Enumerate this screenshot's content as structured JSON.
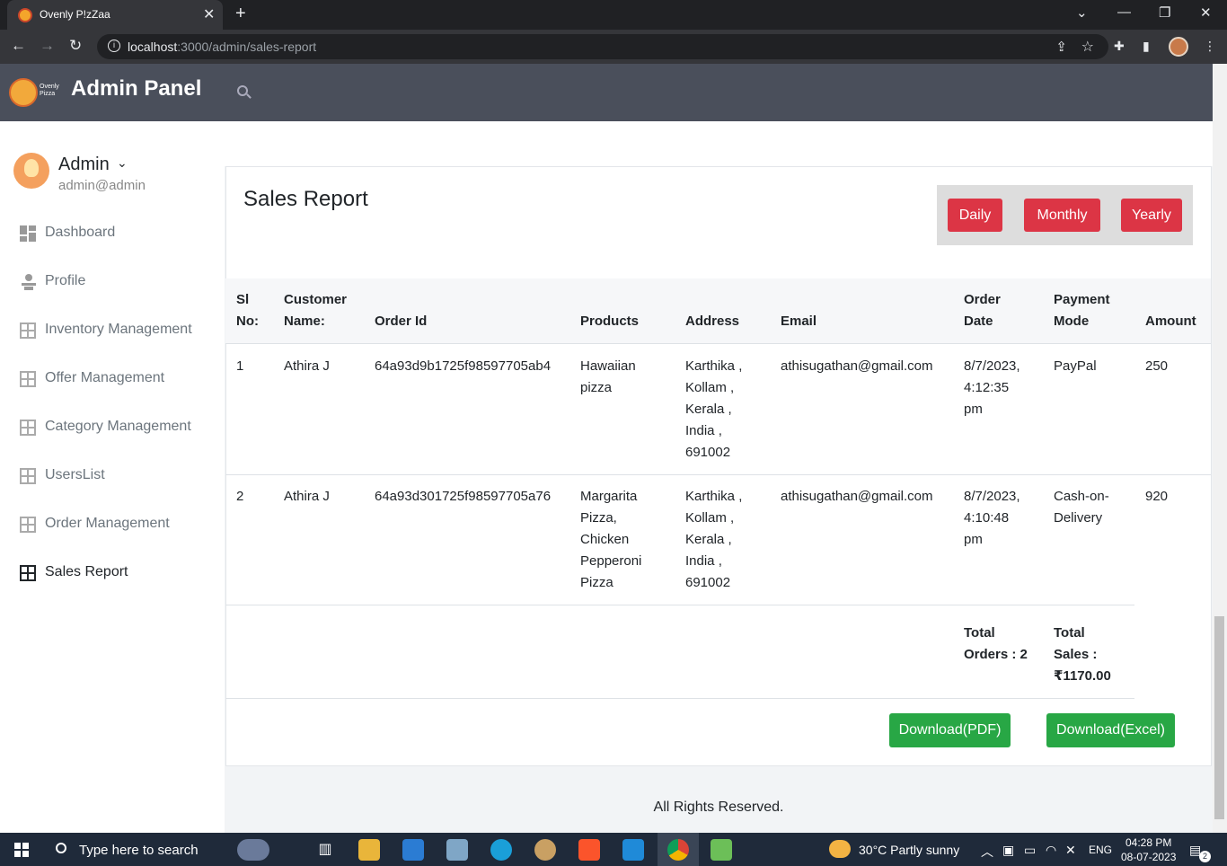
{
  "browser": {
    "tab_title": "Ovenly P!zZaa",
    "url_host": "localhost",
    "url_path": ":3000/admin/sales-report",
    "new_tab": "+",
    "tab_close": "✕"
  },
  "header": {
    "logo_text_line1": "Ovenly",
    "logo_text_line2": "Pizza",
    "title": "Admin Panel"
  },
  "sidebar": {
    "admin_name": "Admin",
    "admin_email": "admin@admin",
    "items": [
      {
        "label": "Dashboard"
      },
      {
        "label": "Profile"
      },
      {
        "label": "Inventory Management"
      },
      {
        "label": "Offer Management"
      },
      {
        "label": "Category Management"
      },
      {
        "label": "UsersList"
      },
      {
        "label": "Order Management"
      },
      {
        "label": "Sales Report"
      }
    ]
  },
  "report": {
    "title": "Sales Report",
    "filters": [
      "Daily",
      "Monthly",
      "Yearly"
    ],
    "columns": {
      "sl_1": "Sl",
      "sl_2": "No:",
      "customer_1": "Customer",
      "customer_2": "Name:",
      "order_id": "Order Id",
      "products": "Products",
      "address": "Address",
      "email": "Email",
      "order_date_1": "Order",
      "order_date_2": "Date",
      "payment_1": "Payment",
      "payment_2": "Mode",
      "amount": "Amount"
    },
    "rows": [
      {
        "sl": "1",
        "customer": "Athira J",
        "order_id": "64a93d9b1725f98597705ab4",
        "products": [
          "Hawaiian",
          "pizza"
        ],
        "address": [
          "Karthika ,",
          "Kollam ,",
          "Kerala ,",
          "India ,",
          "691002"
        ],
        "email": "athisugathan@gmail.com",
        "date": [
          "8/7/2023,",
          "4:12:35",
          "pm"
        ],
        "payment": [
          "PayPal"
        ],
        "amount": "250"
      },
      {
        "sl": "2",
        "customer": "Athira J",
        "order_id": "64a93d301725f98597705a76",
        "products": [
          "Margarita",
          "Pizza,",
          "Chicken",
          "Pepperoni",
          "Pizza"
        ],
        "address": [
          "Karthika ,",
          "Kollam ,",
          "Kerala ,",
          "India ,",
          "691002"
        ],
        "email": "athisugathan@gmail.com",
        "date": [
          "8/7/2023,",
          "4:10:48",
          "pm"
        ],
        "payment": [
          "Cash-on-",
          "Delivery"
        ],
        "amount": "920"
      }
    ],
    "totals": {
      "orders_1": "Total",
      "orders_2": "Orders : 2",
      "sales_1": "Total",
      "sales_2": "Sales :",
      "sales_3": "₹1170.00"
    },
    "download_pdf": "Download(PDF)",
    "download_excel": "Download(Excel)"
  },
  "footer": "All Rights Reserved.",
  "taskbar": {
    "search_placeholder": "Type here to search",
    "weather": "30°C  Partly sunny",
    "lang": "ENG",
    "time": "04:28 PM",
    "date": "08-07-2023",
    "notifications": "2"
  },
  "colors": {
    "accent_red": "#dc3545",
    "accent_green": "#28a745",
    "header_bg": "#4a4f5b"
  }
}
